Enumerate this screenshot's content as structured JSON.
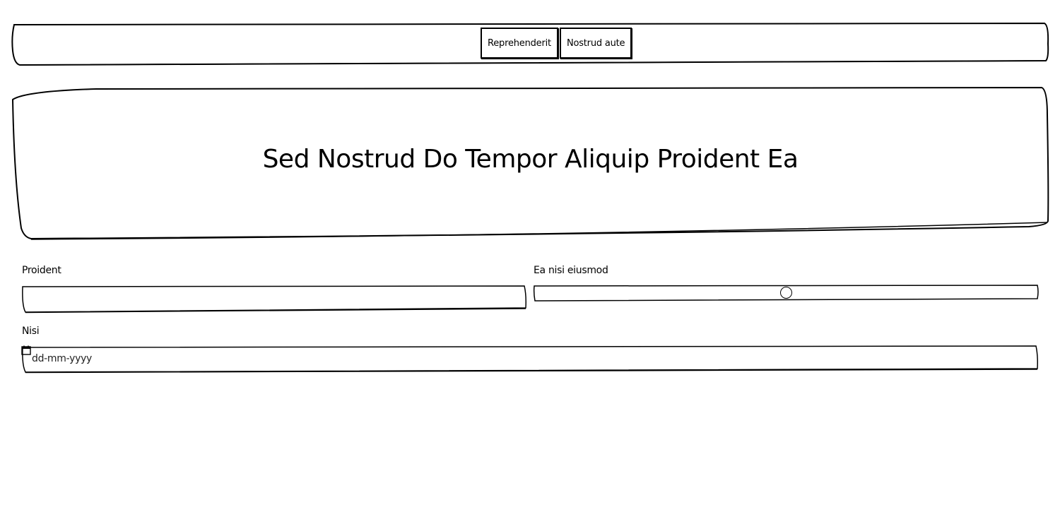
{
  "nav": {
    "buttons": [
      {
        "label": "Reprehenderit"
      },
      {
        "label": "Nostrud aute"
      }
    ]
  },
  "hero": {
    "title": "Sed Nostrud Do Tempor Aliquip Proident Ea"
  },
  "form": {
    "proident": {
      "label": "Proident",
      "value": ""
    },
    "ea_nisi": {
      "label": "Ea nisi eiusmod",
      "value_fraction": 0.5
    },
    "nisi": {
      "label": "Nisi",
      "placeholder": "dd-mm-yyyy",
      "icon": "calendar-icon"
    }
  }
}
